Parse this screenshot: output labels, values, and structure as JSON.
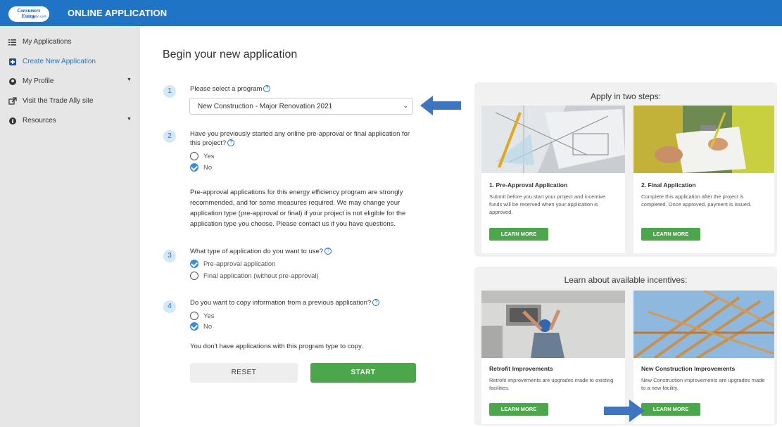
{
  "header": {
    "logo_line1": "Consumers Energy",
    "logo_line2": "Count on Us®",
    "app_title": "ONLINE APPLICATION"
  },
  "sidebar": {
    "items": [
      {
        "label": "My Applications",
        "icon": "list-icon"
      },
      {
        "label": "Create New Application",
        "icon": "plus-box-icon",
        "active": true
      },
      {
        "label": "My Profile",
        "icon": "user-circle-icon",
        "has_caret": true
      },
      {
        "label": "Visit the Trade Ally site",
        "icon": "external-link-icon"
      },
      {
        "label": "Resources",
        "icon": "info-circle-icon",
        "has_caret": true
      }
    ]
  },
  "main": {
    "title": "Begin your new application",
    "step1": {
      "number": "1",
      "question": "Please select a program",
      "selected_program": "New Construction - Major Renovation 2021"
    },
    "step2": {
      "number": "2",
      "question": "Have you previously started any online pre-approval or final application for this project?",
      "options": [
        "Yes",
        "No"
      ],
      "selected": "No",
      "paragraph": "Pre-approval applications for this energy efficiency program are strongly recommended, and for some measures required. We may change your application type (pre-approval or final) if your project is not eligible for the application type you choose. Please contact us if you have questions."
    },
    "step3": {
      "number": "3",
      "question": "What type of application do you want to use?",
      "options": [
        "Pre-approval application",
        "Final application (without pre-approval)"
      ],
      "selected": "Pre-approval application"
    },
    "step4": {
      "number": "4",
      "question": "Do you want to copy information from a previous application?",
      "options": [
        "Yes",
        "No"
      ],
      "selected": "No",
      "note": "You don't have applications with this program type to copy."
    },
    "reset_label": "RESET",
    "start_label": "START"
  },
  "steps_panel": {
    "title": "Apply in two steps:",
    "cards": [
      {
        "title": "1. Pre-Approval Application",
        "desc": "Submit before you start your project and incentive funds will be reserved when your application is approved.",
        "button": "LEARN MORE"
      },
      {
        "title": "2. Final Application",
        "desc": "Complete this application after the project is completed. Once approved, payment is issued.",
        "button": "LEARN MORE"
      }
    ]
  },
  "incentives_panel": {
    "title": "Learn about available incentives:",
    "cards": [
      {
        "title": "Retrofit Improvements",
        "desc": "Retrofit improvements are upgrades made to existing facilities.",
        "button": "LEARN MORE"
      },
      {
        "title": "New Construction Improvements",
        "desc": "New Construction improvements are upgrades made to a new facility.",
        "button": "LEARN MORE"
      }
    ]
  },
  "colors": {
    "brand_blue": "#1f74c6",
    "action_green": "#4ca64c",
    "arrow_blue": "#3f74c0"
  }
}
